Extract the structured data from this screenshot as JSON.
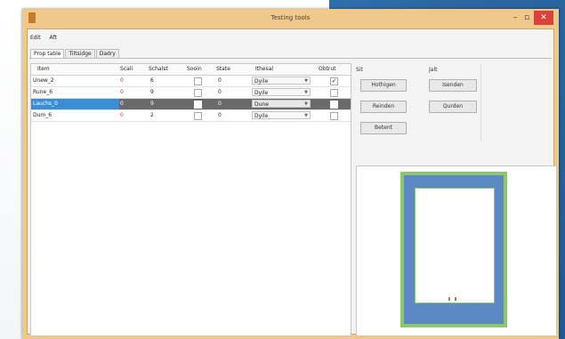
{
  "window": {
    "title": "Testing tools"
  },
  "menu": [
    "Edit",
    "Aft"
  ],
  "tabs": [
    "Prop table",
    "Tiltsidge",
    "Dadry"
  ],
  "grid": {
    "columns": [
      "Item",
      "Scali",
      "Schalst",
      "Sooin",
      "State",
      "Ithesal",
      "Obtrut"
    ],
    "rows": [
      {
        "name": "Unew_2",
        "scali": "0",
        "schalst": "6",
        "sooin": false,
        "state": "0",
        "ithesal": "Dyile",
        "obtrut": true,
        "selected": false
      },
      {
        "name": "Rune_6",
        "scali": "0",
        "schalst": "9",
        "sooin": false,
        "state": "0",
        "ithesal": "Dyile",
        "obtrut": false,
        "selected": false
      },
      {
        "name": "Lauchs_0",
        "scali": "0",
        "schalst": "9",
        "sooin": false,
        "state": "0",
        "ithesal": "Dune",
        "obtrut": false,
        "selected": true
      },
      {
        "name": "Dum_6",
        "scali": "0",
        "schalst": "2",
        "sooin": false,
        "state": "0",
        "ithesal": "Dyile",
        "obtrut": false,
        "selected": false
      }
    ]
  },
  "side": {
    "left_label": "Sit",
    "right_label": "Jalt",
    "buttons_left": [
      "Hothigen",
      "Reinden",
      "Betent"
    ],
    "buttons_right": [
      "Isenden",
      "Qurden"
    ]
  },
  "colors": {
    "accent": "#3b8ed6",
    "title_bar": "#f0c889",
    "preview_green": "#8cc76e",
    "preview_blue": "#5c88c4"
  }
}
